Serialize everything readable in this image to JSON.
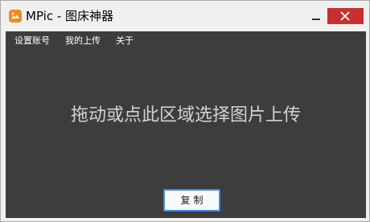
{
  "window": {
    "title": "MPic - 图床神器",
    "app_icon": "mpic-app-icon",
    "controls": {
      "minimize_icon": "minimize-icon",
      "close_icon": "close-icon"
    }
  },
  "menu": {
    "items": [
      {
        "label": "设置账号"
      },
      {
        "label": "我的上传"
      },
      {
        "label": "关于"
      }
    ]
  },
  "drop_zone": {
    "text": "拖动或点此区域选择图片上传"
  },
  "actions": {
    "copy_label": "复制"
  },
  "colors": {
    "content_bg": "#3d3d3d",
    "close_button": "#c7302f",
    "app_icon": "#f08a24",
    "button_border": "#3a8ee6"
  }
}
